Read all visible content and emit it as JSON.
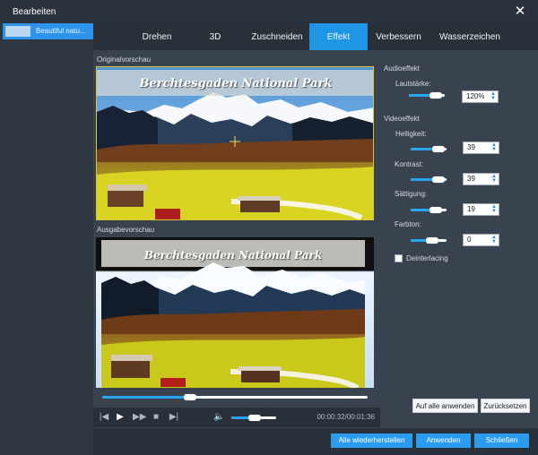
{
  "window": {
    "title": "Bearbeiten"
  },
  "sidebar": {
    "items": [
      {
        "label": "Beautiful natu..."
      }
    ]
  },
  "tabs": [
    {
      "label": "Drehen"
    },
    {
      "label": "3D"
    },
    {
      "label": "Zuschneiden"
    },
    {
      "label": "Effekt"
    },
    {
      "label": "Verbessern"
    },
    {
      "label": "Wasserzeichen"
    }
  ],
  "preview": {
    "original_label": "Originalvorschau",
    "output_label": "Ausgabevorschau",
    "overlay_text": "Berchtesgaden National Park",
    "playback_progress": 0.33,
    "volume_level": 0.52,
    "time": "00:00:32/00:01:36"
  },
  "audio": {
    "section_title": "Audioeffekt",
    "volume_label": "Lautstärke:",
    "volume_value": "120%"
  },
  "video": {
    "section_title": "Videoeffekt",
    "brightness_label": "Helligkeit:",
    "brightness_value": "39",
    "contrast_label": "Kontrast:",
    "contrast_value": "39",
    "saturation_label": "Sättigung:",
    "saturation_value": "19",
    "hue_label": "Farbton:",
    "hue_value": "0",
    "deinterlacing_label": "Deinterlacing"
  },
  "buttons": {
    "apply_all": "Auf alle anwenden",
    "reset": "Zurücksetzen",
    "restore_all": "Alle wiederherstellen",
    "apply": "Anwenden",
    "close": "Schließen"
  },
  "colors": {
    "accent": "#1f95e6",
    "frame_highlight": "#d5c833",
    "background": "#39424f"
  }
}
